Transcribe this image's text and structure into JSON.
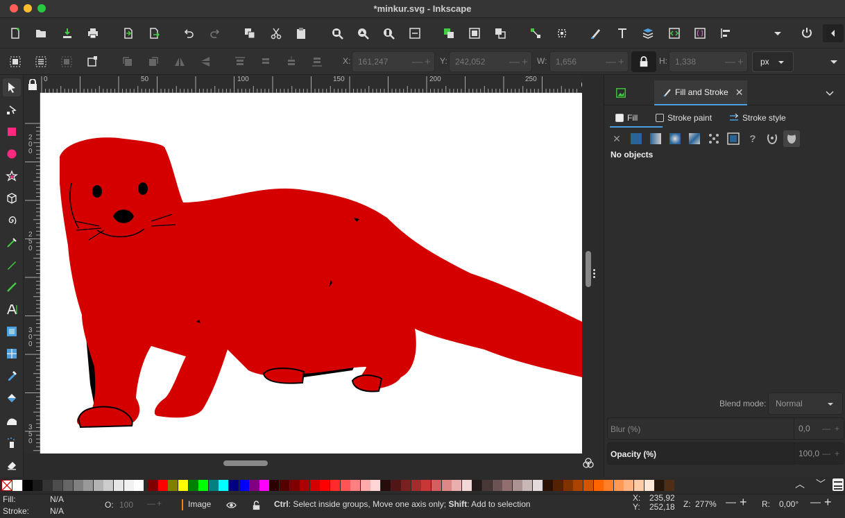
{
  "window": {
    "title": "*minkur.svg - Inkscape"
  },
  "controls": {
    "x_label": "X:",
    "x_value": "161,247",
    "y_label": "Y:",
    "y_value": "242,052",
    "w_label": "W:",
    "w_value": "1,656",
    "h_label": "H:",
    "h_value": "1,338",
    "unit": "px"
  },
  "ruler": {
    "h_ticks": [
      "0",
      "50",
      "100",
      "150",
      "200",
      "250"
    ],
    "v_ticks": [
      "200",
      "250",
      "300",
      "350"
    ]
  },
  "panel": {
    "tab_label": "Fill and Stroke",
    "subtabs": {
      "fill": "Fill",
      "stroke_paint": "Stroke paint",
      "stroke_style": "Stroke style"
    },
    "message": "No objects",
    "blend_label": "Blend mode:",
    "blend_value": "Normal",
    "blur_label": "Blur (%)",
    "blur_value": "0,0",
    "opacity_label": "Opacity (%)",
    "opacity_value": "100,0"
  },
  "status": {
    "fill_label": "Fill:",
    "fill_value": "N/A",
    "stroke_label": "Stroke:",
    "stroke_value": "N/A",
    "opacity_label": "O:",
    "opacity_value": "100",
    "layer": "Image",
    "hint_ctrl": "Ctrl",
    "hint_ctrl_text": ": Select inside groups, Move one axis only; ",
    "hint_shift": "Shift",
    "hint_shift_text": ": Add to selection",
    "cursor_x_label": "X:",
    "cursor_x": "235,92",
    "cursor_y_label": "Y:",
    "cursor_y": "252,18",
    "zoom_label": "Z:",
    "zoom": "277%",
    "rotation_label": "R:",
    "rotation": "0,00°"
  },
  "colors": {
    "accent": "#4aa0e0",
    "object_fill": "#d40000",
    "canvas": "#ffffff"
  },
  "palette": [
    "#ffffff",
    "#000000",
    "#1a1a1a",
    "#333333",
    "#4d4d4d",
    "#666666",
    "#808080",
    "#999999",
    "#b3b3b3",
    "#cccccc",
    "#e6e6e6",
    "#f2f2f2",
    "#ffffff",
    "#800000",
    "#ff0000",
    "#808000",
    "#ffff00",
    "#008000",
    "#00ff00",
    "#008080",
    "#00ffff",
    "#000080",
    "#0000ff",
    "#800080",
    "#ff00ff",
    "#2b0000",
    "#550000",
    "#800000",
    "#aa0000",
    "#d40000",
    "#ff0000",
    "#ff2a2a",
    "#ff5555",
    "#ff8080",
    "#ffaaaa",
    "#ffd5d5",
    "#280b0b",
    "#501616",
    "#782121",
    "#a02c2c",
    "#c83737",
    "#d35f5f",
    "#de8787",
    "#e9afaf",
    "#f4d7d7",
    "#241c1c",
    "#483737",
    "#6c5353",
    "#916f6f",
    "#ac9393",
    "#c8b7b7",
    "#e3dbdb",
    "#2b1100",
    "#552200",
    "#803300",
    "#aa4400",
    "#d45500",
    "#ff6600",
    "#ff7f2a",
    "#ff9955",
    "#ffb380",
    "#ffccaa",
    "#ffe6d5",
    "#28170b",
    "#502d16"
  ]
}
